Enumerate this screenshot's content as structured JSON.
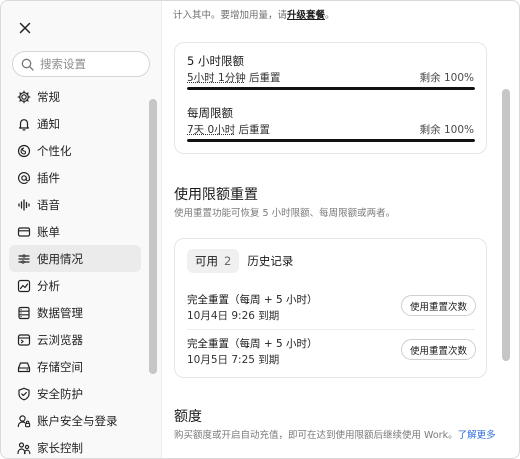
{
  "sidebar": {
    "search_placeholder": "搜索设置",
    "items": [
      {
        "label": "常规",
        "icon": "gear-icon"
      },
      {
        "label": "通知",
        "icon": "bell-icon"
      },
      {
        "label": "个性化",
        "icon": "personalize-icon"
      },
      {
        "label": "插件",
        "icon": "at-icon"
      },
      {
        "label": "语音",
        "icon": "waveform-icon"
      },
      {
        "label": "账单",
        "icon": "card-icon"
      },
      {
        "label": "使用情况",
        "icon": "usage-icon"
      },
      {
        "label": "分析",
        "icon": "chart-icon"
      },
      {
        "label": "数据管理",
        "icon": "database-icon"
      },
      {
        "label": "云浏览器",
        "icon": "browser-icon"
      },
      {
        "label": "存储空间",
        "icon": "storage-icon"
      },
      {
        "label": "安全防护",
        "icon": "shield-icon"
      },
      {
        "label": "账户安全与登录",
        "icon": "account-lock-icon"
      },
      {
        "label": "家长控制",
        "icon": "parental-icon"
      }
    ],
    "active_index": 6
  },
  "main": {
    "top_note_prefix": "计入其中。要增加用量，请",
    "top_note_link": "升级套餐",
    "top_note_suffix": "。",
    "limits": [
      {
        "title": "5 小时限额",
        "reset_time": "5小时 1分钟",
        "reset_suffix": " 后重置",
        "remaining": "剩余 100%",
        "fill_fraction": 1.0
      },
      {
        "title": "每周限额",
        "reset_time": "7天 0小时",
        "reset_suffix": " 后重置",
        "remaining": "剩余 100%",
        "fill_fraction": 1.0
      }
    ],
    "reset_section": {
      "title": "使用限额重置",
      "desc": "使用重置功能可恢复 5 小时限额、每周限额或两者。",
      "tabs": [
        {
          "label": "可用",
          "count": "2"
        },
        {
          "label": "历史记录",
          "count": ""
        }
      ],
      "items": [
        {
          "title": "完全重置（每周 + 5 小时）",
          "expiry": "10月4日 9:26 到期",
          "button": "使用重置次数"
        },
        {
          "title": "完全重置（每周 + 5 小时）",
          "expiry": "10月5日 7:25 到期",
          "button": "使用重置次数"
        }
      ]
    },
    "credit_section": {
      "title": "额度",
      "desc": "购买额度或开启自动充值，即可在达到使用限额后继续使用 Work。",
      "link": "了解更多"
    }
  }
}
